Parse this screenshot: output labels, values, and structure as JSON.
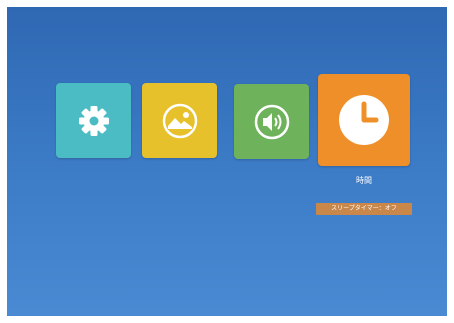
{
  "tiles": [
    {
      "name": "settings",
      "icon": "gear-icon",
      "color": "#4bbcc4"
    },
    {
      "name": "photos",
      "icon": "image-icon",
      "color": "#e6c12c"
    },
    {
      "name": "sound",
      "icon": "speaker-icon",
      "color": "#6fb25c"
    },
    {
      "name": "clock",
      "icon": "clock-icon",
      "color": "#ef8f2a",
      "selected": true
    }
  ],
  "selected": {
    "caption": "時間",
    "hint": "スリープタイマー：オフ"
  },
  "colors": {
    "background_top": "#2f68b3",
    "background_bottom": "#4a8ad3",
    "hint_bg": "#c9874a"
  }
}
